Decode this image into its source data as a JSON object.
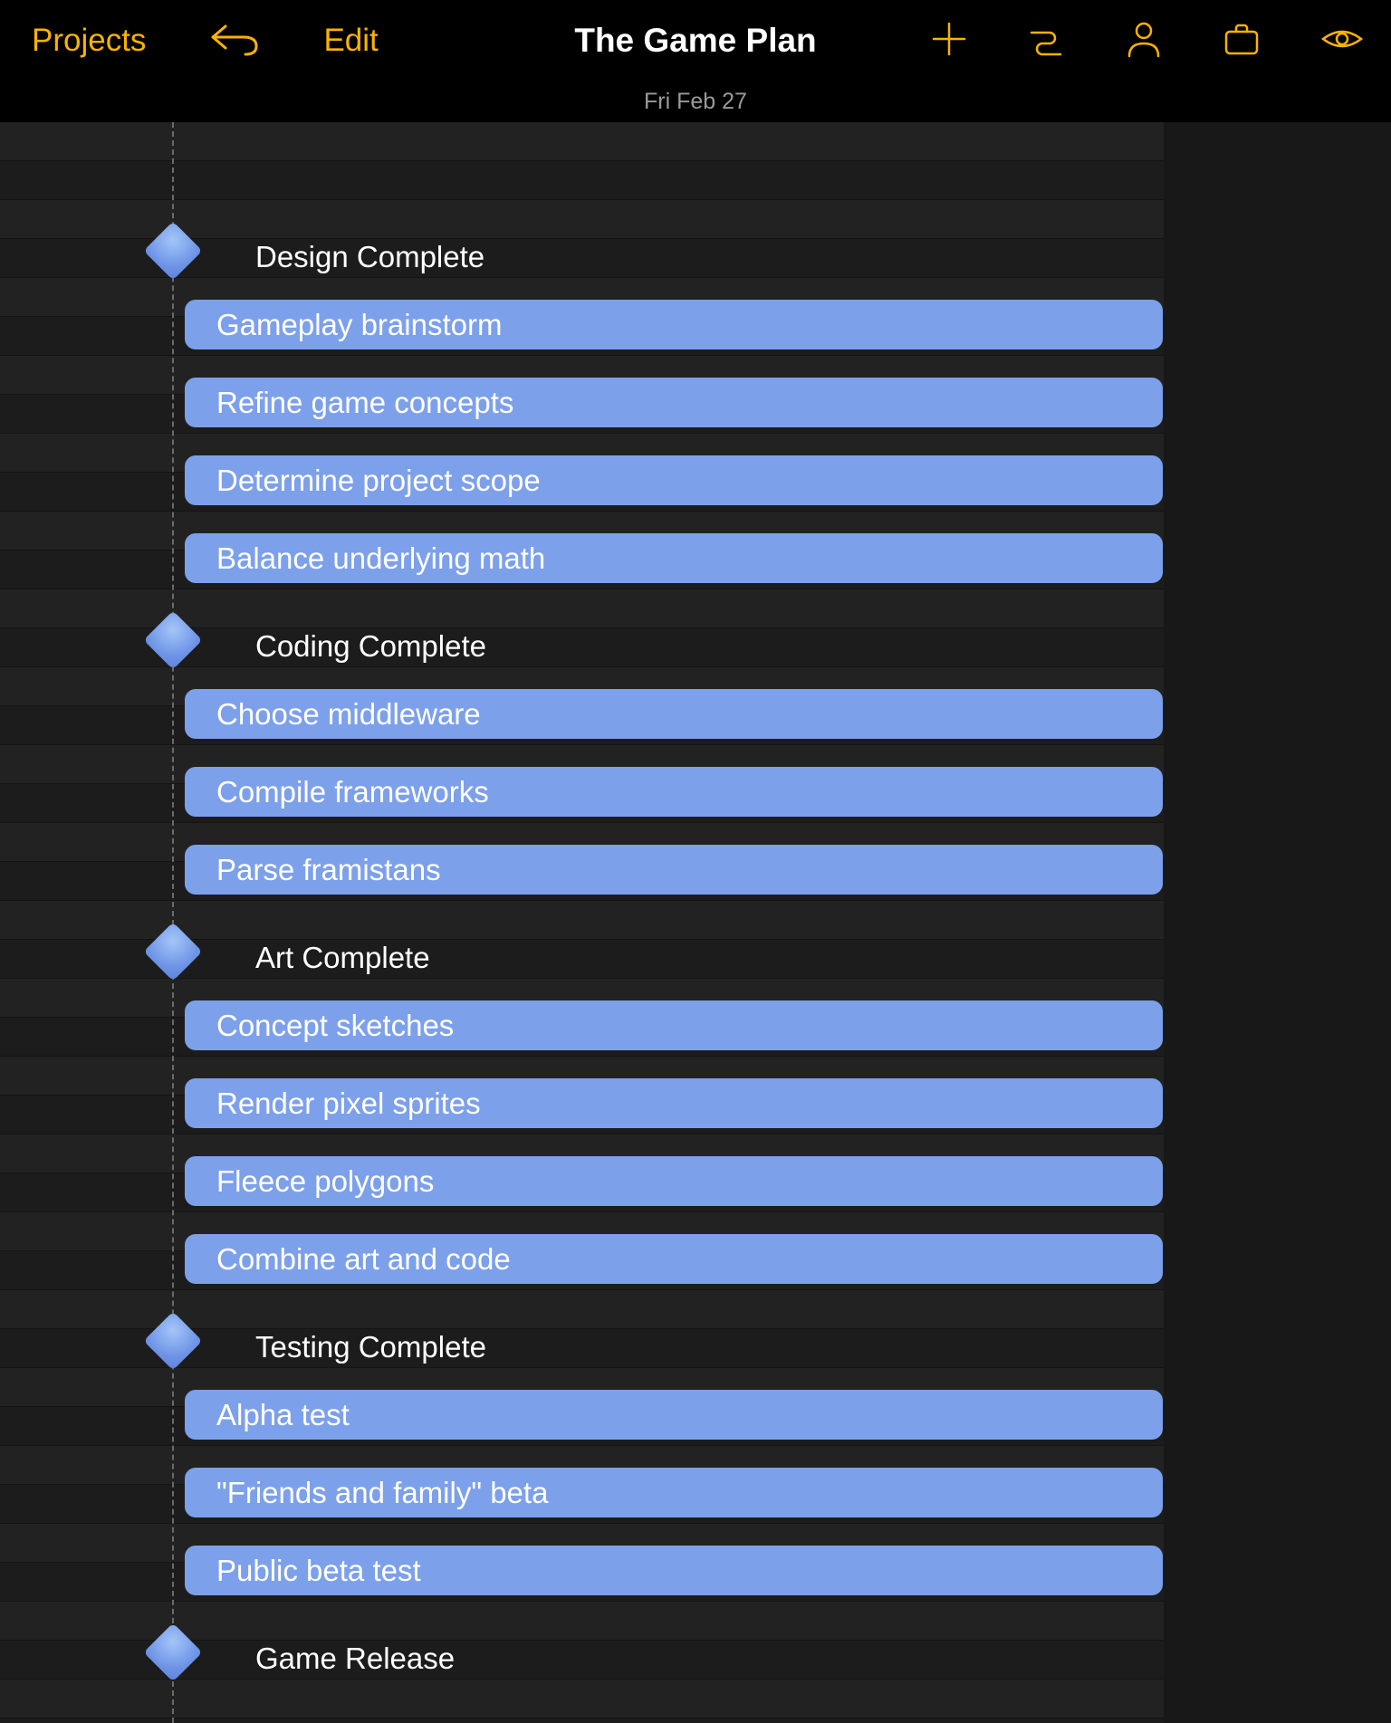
{
  "toolbar": {
    "projects_label": "Projects",
    "edit_label": "Edit",
    "title": "The Game Plan"
  },
  "date_bar": {
    "label": "Fri Feb 27"
  },
  "rows": [
    {
      "type": "milestone",
      "label": "Design Complete"
    },
    {
      "type": "task",
      "label": "Gameplay brainstorm"
    },
    {
      "type": "task",
      "label": "Refine game concepts"
    },
    {
      "type": "task",
      "label": "Determine project scope"
    },
    {
      "type": "task",
      "label": "Balance underlying math"
    },
    {
      "type": "milestone",
      "label": "Coding Complete"
    },
    {
      "type": "task",
      "label": "Choose middleware"
    },
    {
      "type": "task",
      "label": "Compile frameworks"
    },
    {
      "type": "task",
      "label": "Parse framistans"
    },
    {
      "type": "milestone",
      "label": "Art Complete"
    },
    {
      "type": "task",
      "label": "Concept sketches"
    },
    {
      "type": "task",
      "label": "Render pixel sprites"
    },
    {
      "type": "task",
      "label": "Fleece polygons"
    },
    {
      "type": "task",
      "label": "Combine art and code"
    },
    {
      "type": "milestone",
      "label": "Testing Complete"
    },
    {
      "type": "task",
      "label": "Alpha test"
    },
    {
      "type": "task",
      "label": "\"Friends and family\" beta"
    },
    {
      "type": "task",
      "label": "Public beta test"
    },
    {
      "type": "milestone",
      "label": "Game Release"
    }
  ]
}
